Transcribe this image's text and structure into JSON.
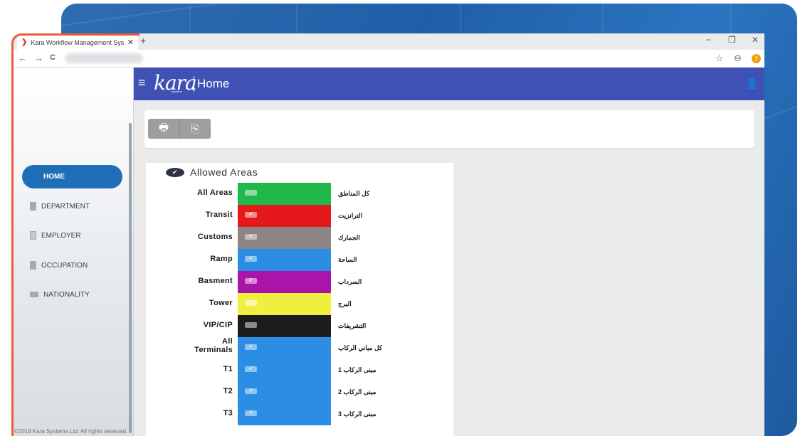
{
  "browser": {
    "tab_title": "Kara Workflow Management Sys",
    "tab_close": "✕",
    "new_tab": "+",
    "minimize": "−",
    "maximize": "❐",
    "close": "✕",
    "back": "←",
    "forward": "→",
    "reload": "C",
    "star": "☆",
    "account": "⊖",
    "alert": "!"
  },
  "sidebar": {
    "active_item": "HOME",
    "items": [
      {
        "label": "DEPARTMENT",
        "icon": "building-icon"
      },
      {
        "label": "EMPLOYER",
        "icon": "document-icon"
      },
      {
        "label": "OCCUPATION",
        "icon": "briefcase-icon"
      },
      {
        "label": "NATIONALITY",
        "icon": "flag-icon"
      }
    ],
    "copyright": "©2019 Kara Systems Ltd. All rights reserved."
  },
  "header": {
    "menu_glyph": "≡",
    "logo": "kara",
    "logo_sub": "systems",
    "title": "Home",
    "user_glyph": "👤"
  },
  "toolbar": {
    "print_glyph": "🖶",
    "export_glyph": "⎘"
  },
  "allowed_areas": {
    "title": "Allowed Areas",
    "check_glyph": "✔",
    "rows": [
      {
        "en": "All Areas",
        "ar": "كل المناطق",
        "color": "#20b84a",
        "check_bg": "#8fd9a4",
        "checked": false
      },
      {
        "en": "Transit",
        "ar": "الترانزيت",
        "color": "#e5191c",
        "check_bg": "#f08b8c",
        "checked": true
      },
      {
        "en": "Customs",
        "ar": "الجمارك",
        "color": "#8d8585",
        "check_bg": "#c2bcbc",
        "checked": true
      },
      {
        "en": "Ramp",
        "ar": "الساحة",
        "color": "#2b8de4",
        "check_bg": "#8fc4f1",
        "checked": true
      },
      {
        "en": "Basment",
        "ar": "السرداب",
        "color": "#a815a8",
        "check_bg": "#d68ad6",
        "checked": true
      },
      {
        "en": "Tower",
        "ar": "البرج",
        "color": "#eef03d",
        "check_bg": "#f7f8a8",
        "checked": false
      },
      {
        "en": "VIP/CIP",
        "ar": "التشريفات",
        "color": "#1c1c1c",
        "check_bg": "#8a8a8a",
        "checked": false
      },
      {
        "en_line1": "All",
        "en_line2": "Terminals",
        "ar": "كل مباني الركاب",
        "color": "#2b8de4",
        "check_bg": "#8fc4f1",
        "checked": true
      },
      {
        "en": "T1",
        "ar": "مبنى الركاب 1",
        "color": "#2b8de4",
        "check_bg": "#8fc4f1",
        "checked": true
      },
      {
        "en": "T2",
        "ar": "مبنى الركاب 2",
        "color": "#2b8de4",
        "check_bg": "#8fc4f1",
        "checked": true
      },
      {
        "en": "T3",
        "ar": "مبنى الركاب 3",
        "color": "#2b8de4",
        "check_bg": "#8fc4f1",
        "checked": true
      }
    ]
  },
  "colors": {
    "header_bg": "#3f51b5",
    "active_nav": "#1f6fb8",
    "accent_frame": "#ec5b35"
  }
}
